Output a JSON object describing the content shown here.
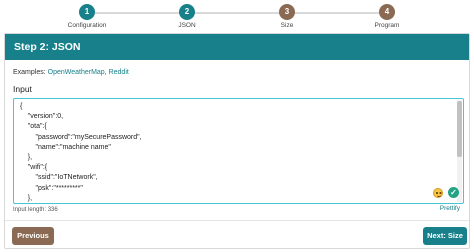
{
  "stepper": {
    "steps": [
      {
        "number": "1",
        "label": "Configuration",
        "state": "active"
      },
      {
        "number": "2",
        "label": "JSON",
        "state": "active"
      },
      {
        "number": "3",
        "label": "Size",
        "state": "inactive"
      },
      {
        "number": "4",
        "label": "Program",
        "state": "inactive"
      }
    ]
  },
  "card": {
    "title": "Step 2: JSON",
    "examples_prefix": "Examples: ",
    "examples": [
      "OpenWeatherMap",
      "Reddit"
    ],
    "examples_separator": ", ",
    "input_label": "Input",
    "editor_content": "{\n    \"version\":0,\n    \"ota\":{\n        \"password\":\"mySecurePassword\",\n        \"name\":\"machine name\"\n    },\n    \"wifi\":{\n        \"ssid\":\"IoTNetwork\",\n        \"psk\":\"*********\"\n    },",
    "input_length": "Input length: 336",
    "prettify_label": "Prettify"
  },
  "buttons": {
    "previous": "Previous",
    "next": "Next: Size"
  },
  "colors": {
    "accent": "#17808a",
    "secondary": "#8a6a52",
    "editor_border": "#45c6d0"
  }
}
